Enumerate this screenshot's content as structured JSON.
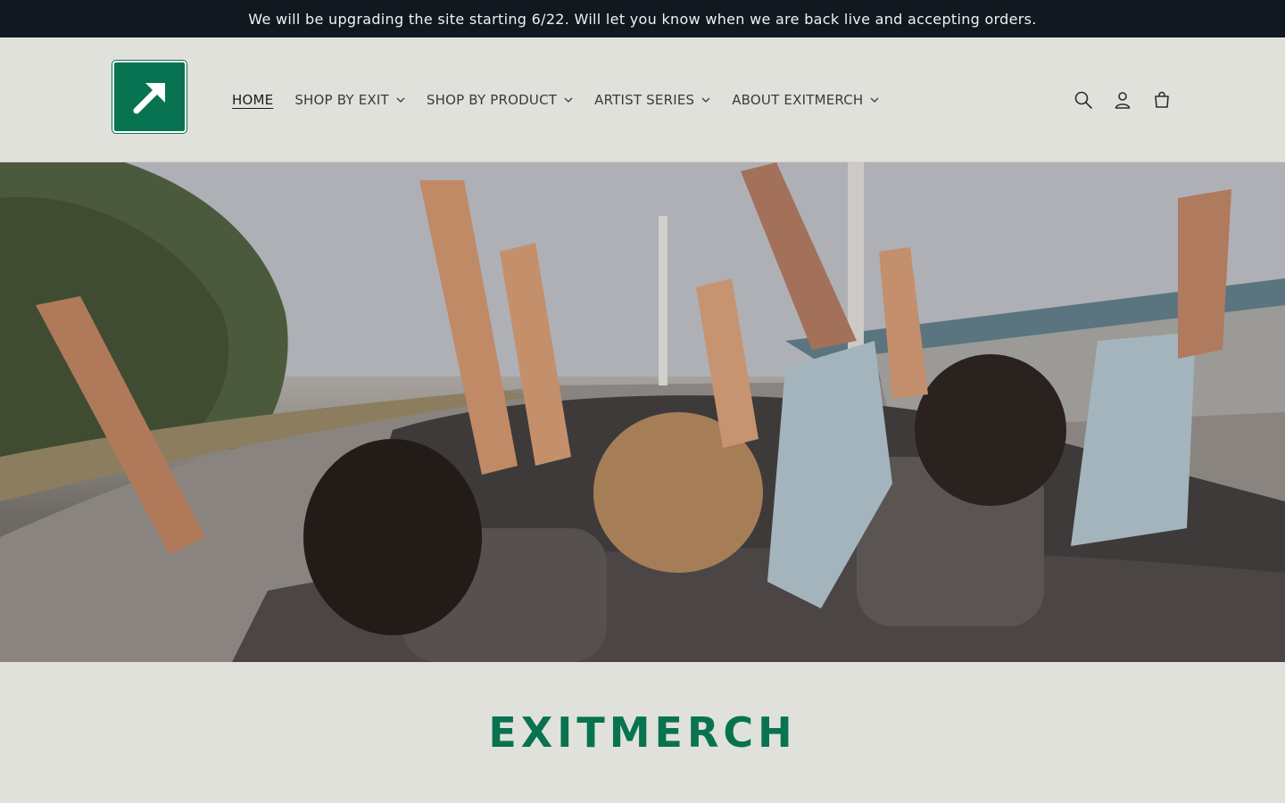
{
  "announcement": {
    "text": "We will be upgrading the site starting 6/22. Will let you know when we are back live and accepting orders."
  },
  "header": {
    "logo_icon": "arrow-up-right-icon",
    "nav": [
      {
        "label": "HOME",
        "active": true
      },
      {
        "label": "SHOP BY EXIT",
        "dropdown": true
      },
      {
        "label": "SHOP BY PRODUCT",
        "dropdown": true
      },
      {
        "label": "ARTIST SERIES",
        "dropdown": true
      },
      {
        "label": "ABOUT EXITMERCH",
        "dropdown": true
      }
    ],
    "icons": [
      "search-icon",
      "account-icon",
      "cart-icon"
    ]
  },
  "brand": {
    "title": "EXITMERCH",
    "color": "#087350"
  },
  "colors": {
    "announcement_bg": "#121820",
    "page_bg": "#e1e1db",
    "accent": "#087350"
  }
}
